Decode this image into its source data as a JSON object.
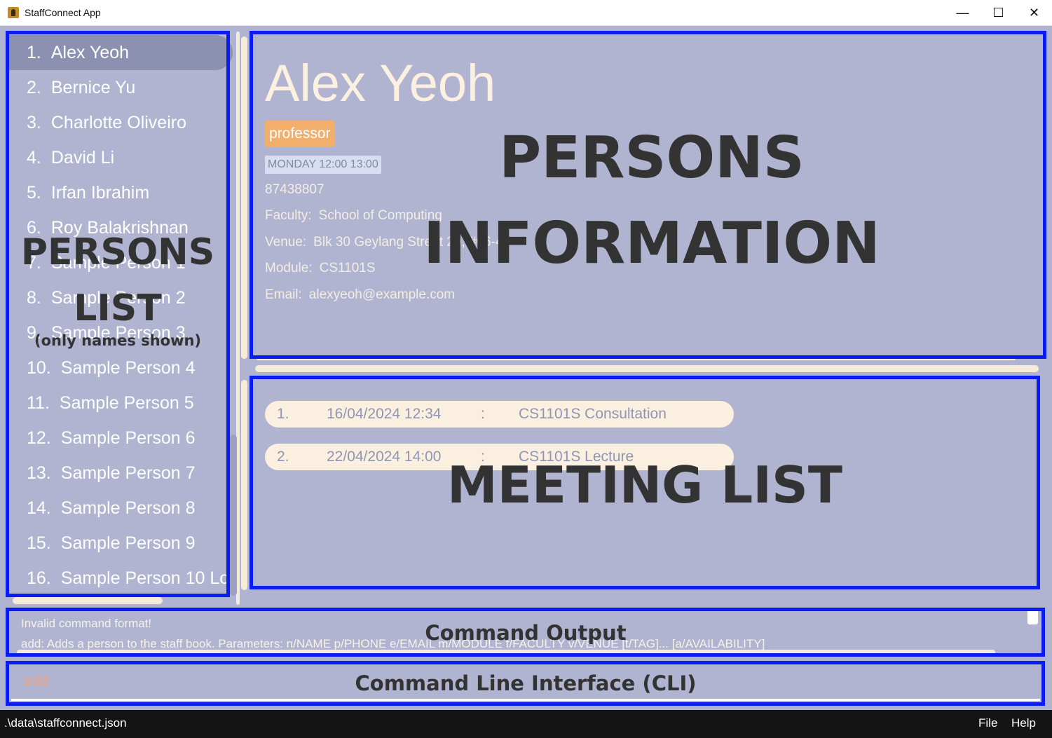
{
  "window": {
    "title": "StaffConnect App",
    "controls": {
      "minimize": "—",
      "maximize": "☐",
      "close": "✕"
    }
  },
  "persons": [
    {
      "index": "1.",
      "name": "Alex Yeoh"
    },
    {
      "index": "2.",
      "name": "Bernice Yu"
    },
    {
      "index": "3.",
      "name": "Charlotte Oliveiro"
    },
    {
      "index": "4.",
      "name": "David Li"
    },
    {
      "index": "5.",
      "name": "Irfan Ibrahim"
    },
    {
      "index": "6.",
      "name": "Roy Balakrishnan"
    },
    {
      "index": "7.",
      "name": "Sample Person 1"
    },
    {
      "index": "8.",
      "name": "Sample Person 2"
    },
    {
      "index": "9.",
      "name": "Sample Person 3"
    },
    {
      "index": "10.",
      "name": "Sample Person 4"
    },
    {
      "index": "11.",
      "name": "Sample Person 5"
    },
    {
      "index": "12.",
      "name": "Sample Person 6"
    },
    {
      "index": "13.",
      "name": "Sample Person 7"
    },
    {
      "index": "14.",
      "name": "Sample Person 8"
    },
    {
      "index": "15.",
      "name": "Sample Person 9"
    },
    {
      "index": "16.",
      "name": "Sample Person 10 Lo"
    }
  ],
  "selected_person": {
    "name": "Alex Yeoh",
    "tag": "professor",
    "availability": "MONDAY 12:00 13:00",
    "phone": "87438807",
    "faculty_label": "Faculty:",
    "faculty": "School of Computing",
    "venue_label": "Venue:",
    "venue": "Blk 30 Geylang Street 29, #06-40",
    "module_label": "Module:",
    "module": "CS1101S",
    "email_label": "Email:",
    "email": "alexyeoh@example.com"
  },
  "meetings": [
    {
      "index": "1.",
      "datetime": "16/04/2024 12:34",
      "sep": ":",
      "description": "CS1101S Consultation"
    },
    {
      "index": "2.",
      "datetime": "22/04/2024 14:00",
      "sep": ":",
      "description": "CS1101S Lecture"
    }
  ],
  "result": {
    "line1": "Invalid command format!",
    "line2": "add: Adds a person to the staff book. Parameters: n/NAME p/PHONE e/EMAIL m/MODULE f/FACULTY v/VENUE [t/TAG]... [a/AVAILABILITY]"
  },
  "cli": {
    "value": "add"
  },
  "status": {
    "path": ".\\data\\staffconnect.json"
  },
  "menu": {
    "file": "File",
    "help": "Help"
  },
  "annotations": {
    "persons_list": "PERSONS\nLIST",
    "persons_list_note": "(only names shown)",
    "persons_info": "PERSONS\nINFORMATION",
    "meeting_list": "MEETING LIST",
    "command_output": "Command Output",
    "cli": "Command Line Interface (CLI)"
  },
  "colors": {
    "background": "#b0b4d0",
    "selected_item": "#8c91b2",
    "tag": "#f2ae6b",
    "annotation_outline": "#0a1cf2",
    "annotation_text": "#333333"
  }
}
